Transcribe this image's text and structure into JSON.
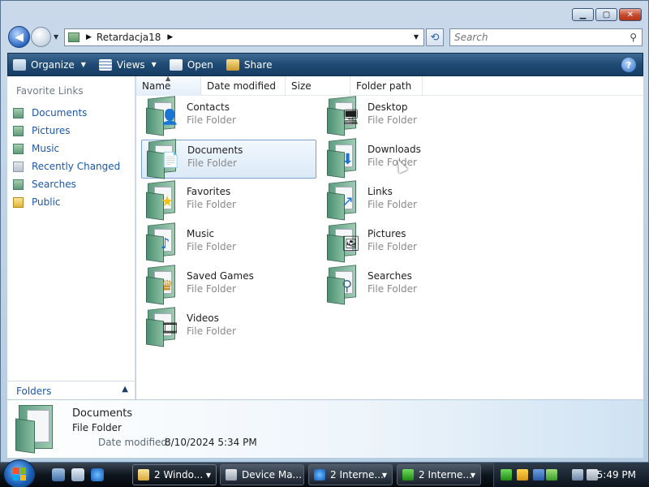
{
  "address": {
    "crumbs": [
      "Retardacja18"
    ]
  },
  "search": {
    "placeholder": "Search"
  },
  "commands": [
    {
      "label": "Organize",
      "icon": "organize-icon",
      "dropdown": true
    },
    {
      "label": "Views",
      "icon": "views-icon",
      "dropdown": true
    },
    {
      "label": "Open",
      "icon": "open-icon",
      "dropdown": false
    },
    {
      "label": "Share",
      "icon": "share-icon",
      "dropdown": false
    }
  ],
  "nav": {
    "title": "Favorite Links",
    "items": [
      "Documents",
      "Pictures",
      "Music",
      "Recently Changed",
      "Searches",
      "Public"
    ],
    "folders_label": "Folders"
  },
  "columns": [
    "Name",
    "Date modified",
    "Size",
    "Folder path"
  ],
  "items": [
    {
      "name": "Contacts",
      "type": "File Folder",
      "icon": "contacts-icon"
    },
    {
      "name": "Desktop",
      "type": "File Folder",
      "icon": "desktop-icon"
    },
    {
      "name": "Documents",
      "type": "File Folder",
      "icon": "documents-icon",
      "selected": true
    },
    {
      "name": "Downloads",
      "type": "File Folder",
      "icon": "downloads-icon"
    },
    {
      "name": "Favorites",
      "type": "File Folder",
      "icon": "favorites-icon"
    },
    {
      "name": "Links",
      "type": "File Folder",
      "icon": "links-icon"
    },
    {
      "name": "Music",
      "type": "File Folder",
      "icon": "music-icon"
    },
    {
      "name": "Pictures",
      "type": "File Folder",
      "icon": "pictures-icon"
    },
    {
      "name": "Saved Games",
      "type": "File Folder",
      "icon": "saved-games-icon"
    },
    {
      "name": "Searches",
      "type": "File Folder",
      "icon": "searches-icon"
    },
    {
      "name": "Videos",
      "type": "File Folder",
      "icon": "videos-icon"
    }
  ],
  "details": {
    "name": "Documents",
    "type": "File Folder",
    "modified_label": "Date modified:",
    "modified_value": "8/10/2024 5:34 PM"
  },
  "taskbar": {
    "buttons": [
      "2 Windo...",
      "Device Ma...",
      "2 Interne...",
      "2 Interne..."
    ],
    "clock": "5:49 PM"
  }
}
